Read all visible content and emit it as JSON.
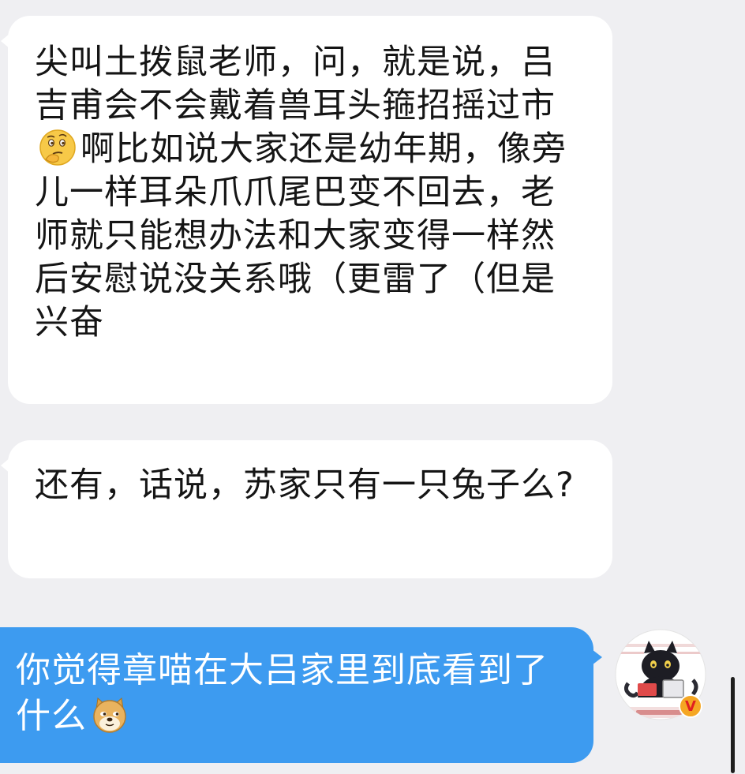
{
  "messages": [
    {
      "direction": "incoming",
      "text_before_emoji": "尖叫土拨鼠老师，问，就是说，吕吉甫会不会戴着兽耳头箍招摇过市",
      "emoji": "thinking-face-icon",
      "text_after_emoji": "啊比如说大家还是幼年期，像旁儿一样耳朵爪爪尾巴变不回去，老师就只能想办法和大家变得一样然后安慰说没关系哦（更雷了（但是兴奋"
    },
    {
      "direction": "incoming",
      "text": "还有，话说，苏家只有一只兔子么?"
    },
    {
      "direction": "outgoing",
      "text": "你觉得章喵在大吕家里到底看到了什么",
      "emoji": "doge-icon"
    }
  ],
  "avatar": {
    "badge": "V",
    "badge_color": "#f5a623",
    "icon": "black-cat-avatar-icon"
  },
  "colors": {
    "background": "#efeff2",
    "incoming_bubble": "#ffffff",
    "outgoing_bubble": "#3d9bf0",
    "text": "#151515"
  }
}
